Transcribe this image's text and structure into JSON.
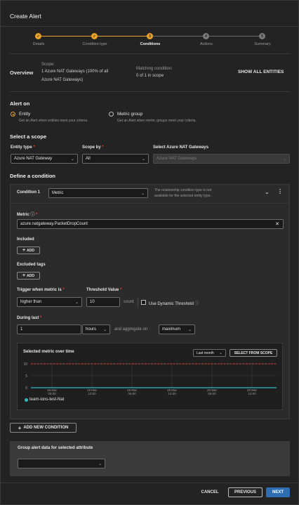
{
  "dialog": {
    "title": "Create Alert"
  },
  "steps": [
    {
      "label": "Details",
      "num": "1",
      "state": "done"
    },
    {
      "label": "Condition type",
      "num": "2",
      "state": "done"
    },
    {
      "label": "Conditions",
      "num": "3",
      "state": "current"
    },
    {
      "label": "Actions",
      "num": "4",
      "state": "todo"
    },
    {
      "label": "Summary",
      "num": "5",
      "state": "todo"
    }
  ],
  "overview": {
    "label": "Overview",
    "scope_label": "Scope:",
    "scope_value_line1": "1 Azure NAT Gateways (100% of all",
    "scope_value_line2": "Azure NAT Gateways)",
    "matching_label": "Matching condition:",
    "matching_value": "0 of 1 in scope",
    "show_all": "SHOW ALL ENTITIES"
  },
  "alert_on": {
    "heading": "Alert on",
    "entity_label": "Entity",
    "entity_desc": "Get an Alert when entities meet your criteria.",
    "metric_group_label": "Metric group",
    "metric_group_desc": "Get an Alert when metric groups meet your criteria."
  },
  "scope": {
    "heading": "Select a scope",
    "entity_type_label": "Entity type",
    "entity_type_value": "Azure NAT Gateway",
    "scope_by_label": "Scope by",
    "scope_by_value": "All",
    "select_label": "Select Azure NAT Gateways",
    "select_placeholder": "Azure NAT Gateways"
  },
  "condition": {
    "heading": "Define a condition",
    "cond_label": "Condition 1",
    "cond_type": "Metric",
    "cond_note_line1": "The relationship condition type is not",
    "cond_note_line2": "available for the selected entity type.",
    "metric_label": "Metric",
    "metric_value": "azure.natgateway.PacketDropCount",
    "included_label": "Included",
    "add_label": "ADD",
    "excluded_label": "Excluded tags",
    "trigger_label": "Trigger when metric is",
    "trigger_value": "higher than",
    "threshold_label": "Threshold Value",
    "threshold_value": "10",
    "count_label": "count",
    "dynamic_label": "Use Dynamic Threshold",
    "during_label": "During last",
    "during_value": "1",
    "unit_value": "hours",
    "aggregate_label": "and aggregate on",
    "aggregate_value": "maximum"
  },
  "chart_data": {
    "type": "line",
    "title": "Selected metric over time",
    "range_select": "Last month",
    "select_from_scope": "SELECT FROM SCOPE",
    "x": [
      "18 Mar\n06:00",
      "18 Mar\n12:00",
      "19 Mar\n06:00",
      "19 Mar\n12:00",
      "20 Mar\n06:00",
      "20 Mar\n12:00"
    ],
    "x_tick_dates": [
      "18 Mar",
      "19 Mar",
      "19 Mar",
      "19 Mar",
      "20 Mar",
      "20 Mar"
    ],
    "x_tick_times": [
      "06:00",
      "12:00",
      "06:00",
      "12:00",
      "06:00",
      "12:00"
    ],
    "y_ticks": [
      "10",
      "5",
      "0"
    ],
    "ylim": [
      0,
      10
    ],
    "threshold": 10,
    "series": [
      {
        "name": "team-ions-test-Nat",
        "values": [
          0,
          0,
          0,
          0,
          0,
          0
        ],
        "color": "#2fb7c4"
      }
    ],
    "threshold_color": "#d0443a"
  },
  "add_condition": "ADD NEW CONDITION",
  "group": {
    "label": "Group alert data for selected attribute",
    "value": ""
  },
  "footer": {
    "cancel": "CANCEL",
    "previous": "PREVIOUS",
    "next": "NEXT"
  },
  "colors": {
    "accent": "#e9a12a",
    "primary_button": "#2f6db3"
  }
}
